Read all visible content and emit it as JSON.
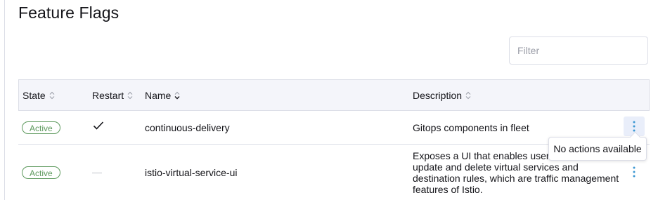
{
  "page": {
    "title": "Feature Flags"
  },
  "filter": {
    "placeholder": "Filter",
    "value": ""
  },
  "table": {
    "columns": [
      {
        "label": "State",
        "sort": "none"
      },
      {
        "label": "Restart",
        "sort": "none"
      },
      {
        "label": "Name",
        "sort": "ascending"
      },
      {
        "label": "Description",
        "sort": "none"
      }
    ],
    "rows": [
      {
        "state": "Active",
        "restart": "checkmark-icon",
        "name": "continuous-delivery",
        "description": "Gitops components in fleet"
      },
      {
        "state": "Active",
        "restart": "—",
        "name": "istio-virtual-service-ui",
        "description_lines": [
          "Exposes a UI that enables users",
          "update and delete virtual services and",
          "destination rules, which are traffic management",
          "features of Istio."
        ]
      }
    ]
  },
  "tooltip": {
    "text": "No actions available"
  },
  "colors": {
    "active_badge": "#5d995d",
    "header_bg": "#f4f5fa",
    "border": "#dcdee7",
    "action_icon": "#3d98d3",
    "action_active_bg": "#e9eefa"
  }
}
